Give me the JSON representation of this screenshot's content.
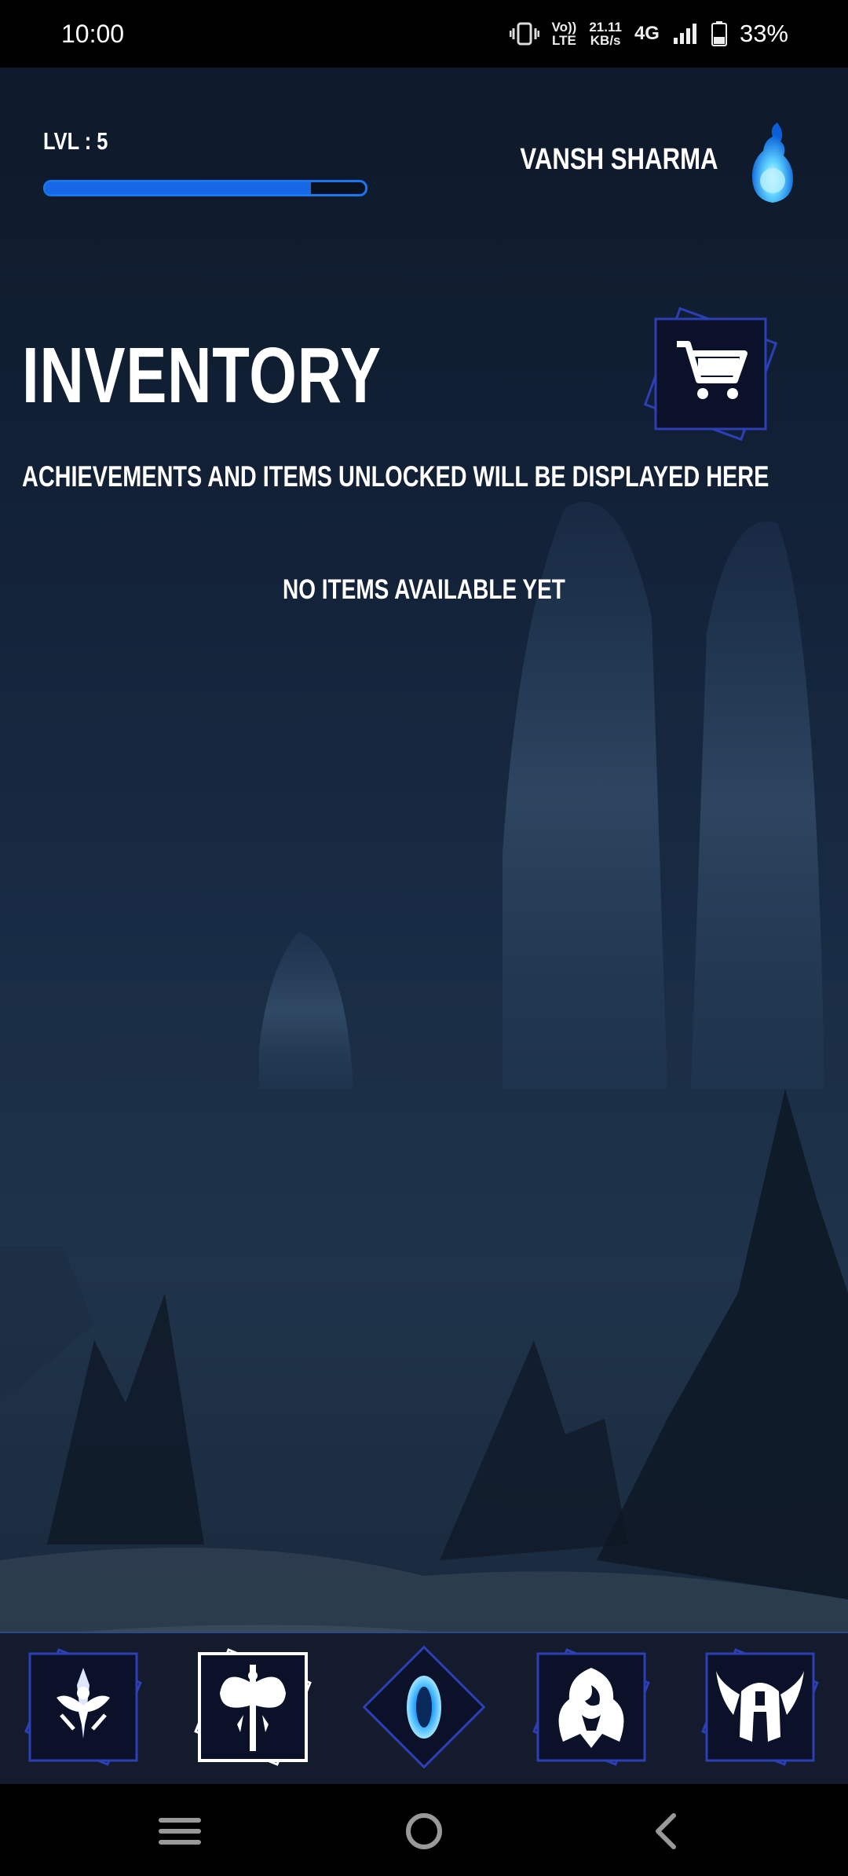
{
  "status_bar": {
    "time": "10:00",
    "volte_top": "Vo))",
    "volte_bottom": "LTE",
    "speed_top": "21.11",
    "speed_bottom": "KB/s",
    "network": "4G",
    "battery": "33%",
    "icons": [
      "vibrate-icon",
      "signal-icon",
      "battery-icon"
    ]
  },
  "header": {
    "level_label": "LVL : 5",
    "xp_progress": 0.83,
    "player_name": "VANSH SHARMA",
    "avatar_icon": "blue-flame-icon"
  },
  "main": {
    "title": "INVENTORY",
    "subtitle": "ACHIEVEMENTS AND ITEMS UNLOCKED WILL BE DISPLAYED HERE",
    "empty_message": "NO ITEMS AVAILABLE YET",
    "shop_icon": "shopping-cart-icon"
  },
  "bottom_nav": {
    "items": [
      {
        "icon": "sword-emblem-icon",
        "selected": false
      },
      {
        "icon": "battle-axe-icon",
        "selected": true
      },
      {
        "icon": "portal-icon",
        "selected": false
      },
      {
        "icon": "phoenix-emblem-icon",
        "selected": false
      },
      {
        "icon": "winged-helmet-icon",
        "selected": false
      }
    ]
  },
  "system_nav": {
    "buttons": [
      "menu-icon",
      "home-icon",
      "back-icon"
    ]
  },
  "colors": {
    "accent": "#1668e4",
    "frame": "#2a3a9a",
    "selected_frame": "#ffffff"
  }
}
